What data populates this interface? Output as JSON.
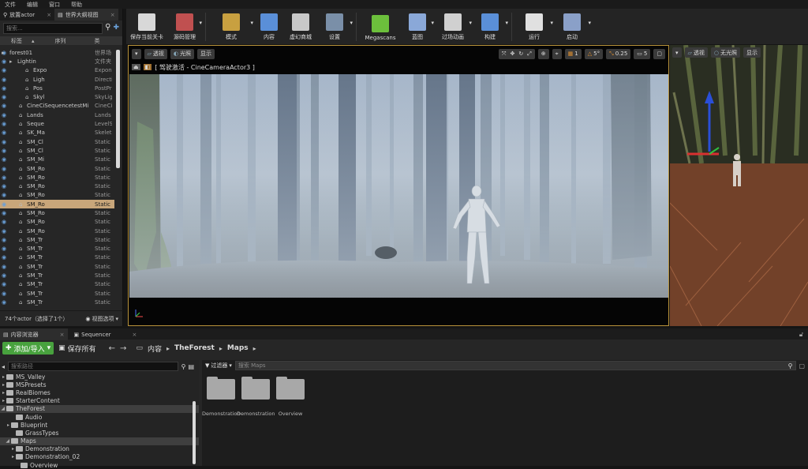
{
  "menu": [
    "文件",
    "编辑",
    "窗口",
    "帮助"
  ],
  "outliner": {
    "tabs": [
      {
        "label": "放置actor"
      },
      {
        "label": "世界大纲视图"
      }
    ],
    "search_placeholder": "搜索...",
    "columns": {
      "label": "标签",
      "sort": "序列",
      "type": "类"
    },
    "rows": [
      {
        "name": "forest01",
        "type": "世界场",
        "indent": 12,
        "eye": true
      },
      {
        "name": "Lightin",
        "type": "文件夹",
        "indent": 22,
        "eye": true
      },
      {
        "name": "Expo",
        "type": "Expon",
        "indent": 42,
        "eye": true
      },
      {
        "name": "Ligh",
        "type": "Directi",
        "indent": 42,
        "eye": true
      },
      {
        "name": "Pos",
        "type": "PostPr",
        "indent": 42,
        "eye": true
      },
      {
        "name": "Skyl",
        "type": "SkyLig",
        "indent": 42,
        "eye": true
      },
      {
        "name": "CineCiSequencetestMi",
        "type": "CineCi",
        "indent": 34,
        "eye": true
      },
      {
        "name": "Lands",
        "type": "Lands",
        "indent": 34,
        "eye": true
      },
      {
        "name": "Seque",
        "type": "LevelS",
        "indent": 34,
        "eye": true
      },
      {
        "name": "SK_Ma",
        "type": "Skelet",
        "indent": 34,
        "eye": true
      },
      {
        "name": "SM_Cl",
        "type": "Static",
        "indent": 34,
        "eye": true
      },
      {
        "name": "SM_Cl",
        "type": "Static",
        "indent": 34,
        "eye": true
      },
      {
        "name": "SM_Mi",
        "type": "Static",
        "indent": 34,
        "eye": true
      },
      {
        "name": "SM_Ro",
        "type": "Static",
        "indent": 34,
        "eye": true
      },
      {
        "name": "SM_Ro",
        "type": "Static",
        "indent": 34,
        "eye": true
      },
      {
        "name": "SM_Ro",
        "type": "Static",
        "indent": 34,
        "eye": true
      },
      {
        "name": "SM_Ro",
        "type": "Static",
        "indent": 34,
        "eye": true
      },
      {
        "name": "SM_Ro",
        "type": "Static",
        "indent": 34,
        "eye": true,
        "selected": true
      },
      {
        "name": "SM_Ro",
        "type": "Static",
        "indent": 34,
        "eye": true
      },
      {
        "name": "SM_Ro",
        "type": "Static",
        "indent": 34,
        "eye": true
      },
      {
        "name": "SM_Ro",
        "type": "Static",
        "indent": 34,
        "eye": true
      },
      {
        "name": "SM_Tr",
        "type": "Static",
        "indent": 34,
        "eye": true
      },
      {
        "name": "SM_Tr",
        "type": "Static",
        "indent": 34,
        "eye": true
      },
      {
        "name": "SM_Tr",
        "type": "Static",
        "indent": 34,
        "eye": true
      },
      {
        "name": "SM_Tr",
        "type": "Static",
        "indent": 34,
        "eye": true
      },
      {
        "name": "SM_Tr",
        "type": "Static",
        "indent": 34,
        "eye": true
      },
      {
        "name": "SM_Tr",
        "type": "Static",
        "indent": 34,
        "eye": true
      },
      {
        "name": "SM_Tr",
        "type": "Static",
        "indent": 34,
        "eye": true
      },
      {
        "name": "SM_Tr",
        "type": "Static",
        "indent": 34,
        "eye": true
      }
    ],
    "footer": "74个actor（选择了1个）",
    "view_options": "视图选项"
  },
  "toolbar": [
    {
      "label": "保存当前关卡",
      "icon": "save-icon",
      "color": "#d8d8d8"
    },
    {
      "label": "源码管理",
      "icon": "source-control-icon",
      "color": "#c05050"
    },
    {
      "label": "模式",
      "icon": "modes-icon",
      "color": "#c8a040"
    },
    {
      "label": "内容",
      "icon": "content-icon",
      "color": "#5a8fd8"
    },
    {
      "label": "虚幻商城",
      "icon": "marketplace-icon",
      "color": "#c8c8c8"
    },
    {
      "label": "设置",
      "icon": "settings-icon",
      "color": "#7a8fa8"
    },
    {
      "label": "Megascans",
      "icon": "megascans-icon",
      "color": "#6cbf3c"
    },
    {
      "label": "蓝图",
      "icon": "blueprint-icon",
      "color": "#8aa8d8"
    },
    {
      "label": "过场动画",
      "icon": "cinematics-icon",
      "color": "#d0d0d0"
    },
    {
      "label": "构建",
      "icon": "build-icon",
      "color": "#5a8fd8"
    },
    {
      "label": "运行",
      "icon": "play-icon",
      "color": "#e0e0e0"
    },
    {
      "label": "启动",
      "icon": "launch-icon",
      "color": "#8aa0c8"
    }
  ],
  "viewport": {
    "perspective": "透视",
    "lit": "光照",
    "show": "显示",
    "pilot_label": "[ 驾驶激活 - CineCameraActor3 ]",
    "grid_snap": "1",
    "angle_snap": "5°",
    "scale_snap": "0.25",
    "camera_speed": "5"
  },
  "viewport2": {
    "perspective": "透视",
    "lit": "无光照",
    "show": "显示"
  },
  "content_browser": {
    "tabs": [
      {
        "label": "内容浏览器"
      },
      {
        "label": "Sequencer"
      }
    ],
    "add_import": "添加/导入",
    "save_all": "保存所有",
    "breadcrumb": [
      "内容",
      "TheForest",
      "Maps"
    ],
    "search_path_placeholder": "搜索路径",
    "filters": "过滤器",
    "search_maps_placeholder": "搜索 Maps",
    "tree": [
      {
        "label": "MS_Valley",
        "indent": 8,
        "arrow": "▸"
      },
      {
        "label": "MSPresets",
        "indent": 8,
        "arrow": "▸"
      },
      {
        "label": "RealBiomes",
        "indent": 8,
        "arrow": "▸"
      },
      {
        "label": "StarterContent",
        "indent": 8,
        "arrow": "▸"
      },
      {
        "label": "TheForest",
        "indent": 8,
        "arrow": "◢",
        "hl": true
      },
      {
        "label": "Audio",
        "indent": 20,
        "arrow": ""
      },
      {
        "label": "Blueprint",
        "indent": 14,
        "arrow": "▸"
      },
      {
        "label": "GrassTypes",
        "indent": 20,
        "arrow": ""
      },
      {
        "label": "Maps",
        "indent": 14,
        "arrow": "◢",
        "hl": true
      },
      {
        "label": "Demonstration",
        "indent": 20,
        "arrow": "▸"
      },
      {
        "label": "Demonstration_02",
        "indent": 20,
        "arrow": "▸"
      },
      {
        "label": "Overview",
        "indent": 26,
        "arrow": ""
      }
    ],
    "assets": [
      {
        "label": "Demonstration"
      },
      {
        "label": "Demonstration_02"
      },
      {
        "label": "Overview"
      }
    ]
  }
}
